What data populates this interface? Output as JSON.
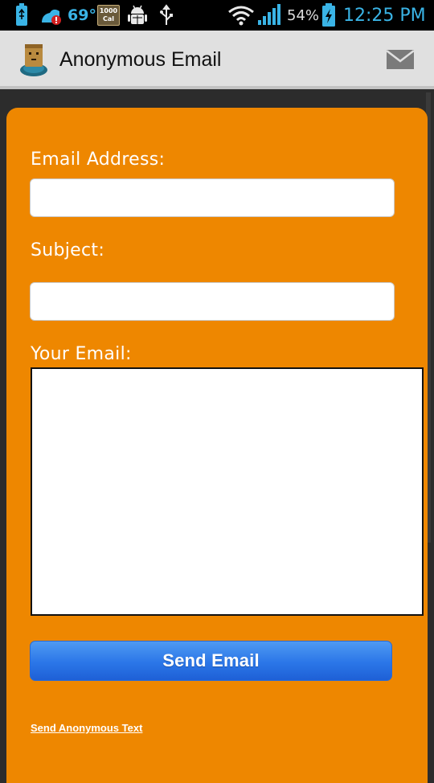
{
  "status_bar": {
    "temperature": "69°",
    "calorie_badge_top": "1000",
    "calorie_badge_bottom": "Cal",
    "battery_percent": "54%",
    "time": "12:25 PM",
    "icons": [
      "usb-battery-icon",
      "weather-alert-icon",
      "calorie-icon",
      "android-debug-icon",
      "usb-icon",
      "wifi-icon",
      "signal-icon",
      "battery-charging-icon"
    ],
    "accent_color": "#3ab4e6"
  },
  "action_bar": {
    "title": "Anonymous Email",
    "app_icon": "anonymous-mascot-icon",
    "action_icon": "mail-icon"
  },
  "form": {
    "email_label": "Email Address:",
    "email_value": "",
    "subject_label": "Subject:",
    "subject_value": "",
    "body_label": "Your Email:",
    "body_value": "",
    "send_button_label": "Send Email",
    "alt_link_label": "Send Anonymous Text"
  },
  "colors": {
    "card_background": "#ee8700",
    "button_blue": "#2b76e8",
    "action_bar": "#e0e0e0"
  }
}
